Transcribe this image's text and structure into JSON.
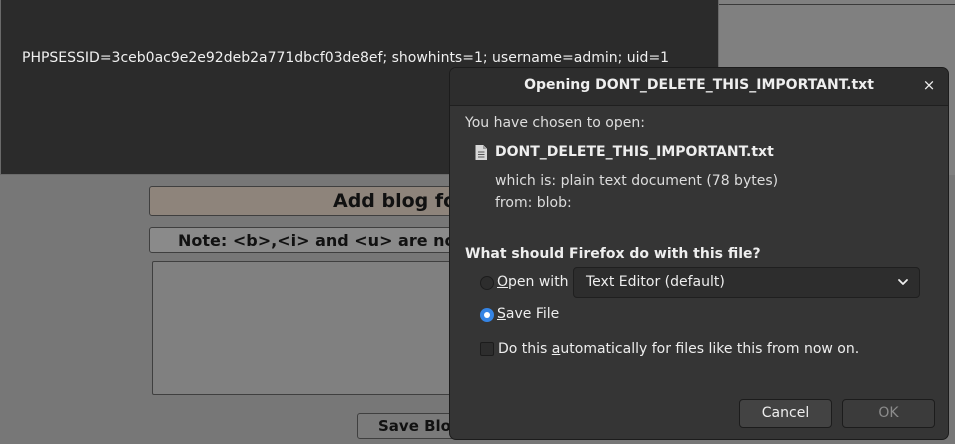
{
  "background_page": {
    "blog_header": "Add blog fo",
    "note": "Note: <b>,<i> and <u> are no",
    "save_button": "Save Blog E"
  },
  "cookie_alert": {
    "text": "PHPSESSID=3ceb0ac9e2e92deb2a771dbcf03de8ef; showhints=1; username=admin; uid=1"
  },
  "dialog": {
    "title": "Opening DONT_DELETE_THIS_IMPORTANT.txt",
    "close_glyph": "×",
    "chosen_label": "You have chosen to open:",
    "file_icon": "document-icon",
    "filename": "DONT_DELETE_THIS_IMPORTANT.txt",
    "which_is_label": "which is:",
    "which_is_value": "plain text document (78 bytes)",
    "from_label": "from:",
    "from_value": "blob:",
    "question": "What should Firefox do with this file?",
    "open_with": {
      "mnemonic": "O",
      "rest": "pen with",
      "selected": false,
      "app": "Text Editor (default)"
    },
    "save_file": {
      "mnemonic": "S",
      "rest": "ave File",
      "selected": true
    },
    "auto": {
      "before": "Do this ",
      "mnemonic": "a",
      "after": "utomatically for files like this from now on.",
      "checked": false
    },
    "cancel_label": "Cancel",
    "ok_label": "OK",
    "accent_color": "#3584e4"
  }
}
